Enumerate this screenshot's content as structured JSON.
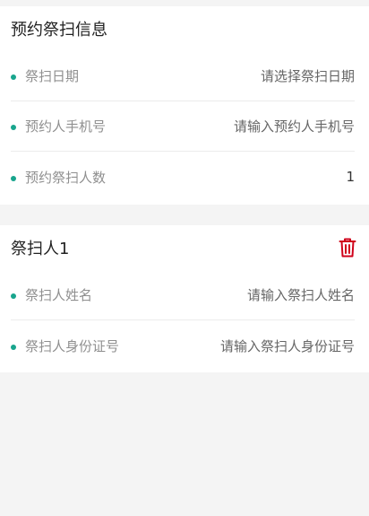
{
  "booking": {
    "title": "预约祭扫信息",
    "fields": [
      {
        "label": "祭扫日期",
        "value": "请选择祭扫日期"
      },
      {
        "label": "预约人手机号",
        "value": "请输入预约人手机号"
      },
      {
        "label": "预约祭扫人数",
        "value": "1"
      }
    ]
  },
  "visitor": {
    "title": "祭扫人1",
    "delete_icon": "trash-icon",
    "delete_color": "#d0021b",
    "fields": [
      {
        "label": "祭扫人姓名",
        "value": "请输入祭扫人姓名"
      },
      {
        "label": "祭扫人身份证号",
        "value": "请输入祭扫人身份证号"
      }
    ]
  }
}
